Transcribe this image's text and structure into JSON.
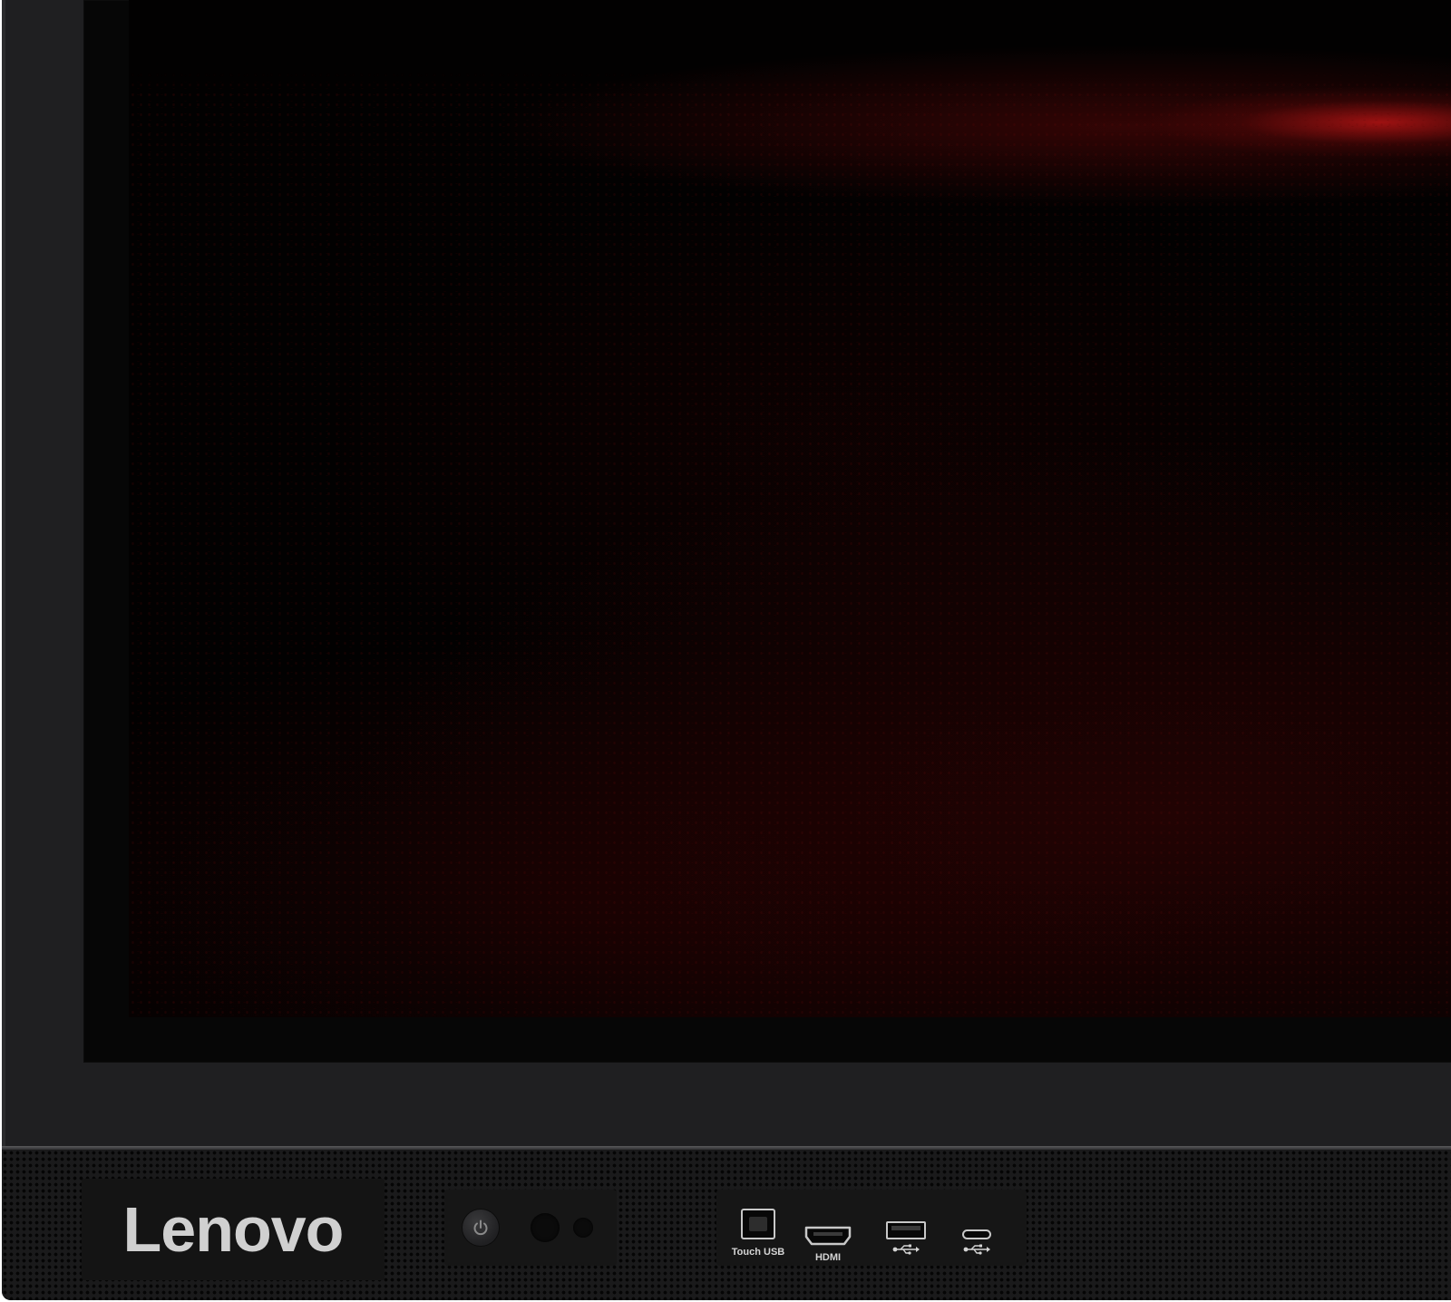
{
  "brand": {
    "logo_text": "Lenovo"
  },
  "controls": {
    "power_icon": "power-icon",
    "sensors": [
      "light-sensor",
      "ir-receiver"
    ]
  },
  "ports": [
    {
      "label": "Touch USB",
      "icon": "usb-type-b-port-icon"
    },
    {
      "label": "HDMI",
      "icon": "hdmi-port-icon"
    },
    {
      "label": "",
      "icon": "usb-symbol-icon",
      "connector": "usb-type-a-port-icon"
    },
    {
      "label": "",
      "icon": "usb-symbol-icon",
      "connector": "usb-type-c-port-icon"
    }
  ],
  "colors": {
    "bezel": "#1f1f21",
    "screen": "#020101",
    "screen_highlight": "#b41414",
    "port_outline": "#c8c8c8",
    "logo": "#d0d0d0"
  }
}
